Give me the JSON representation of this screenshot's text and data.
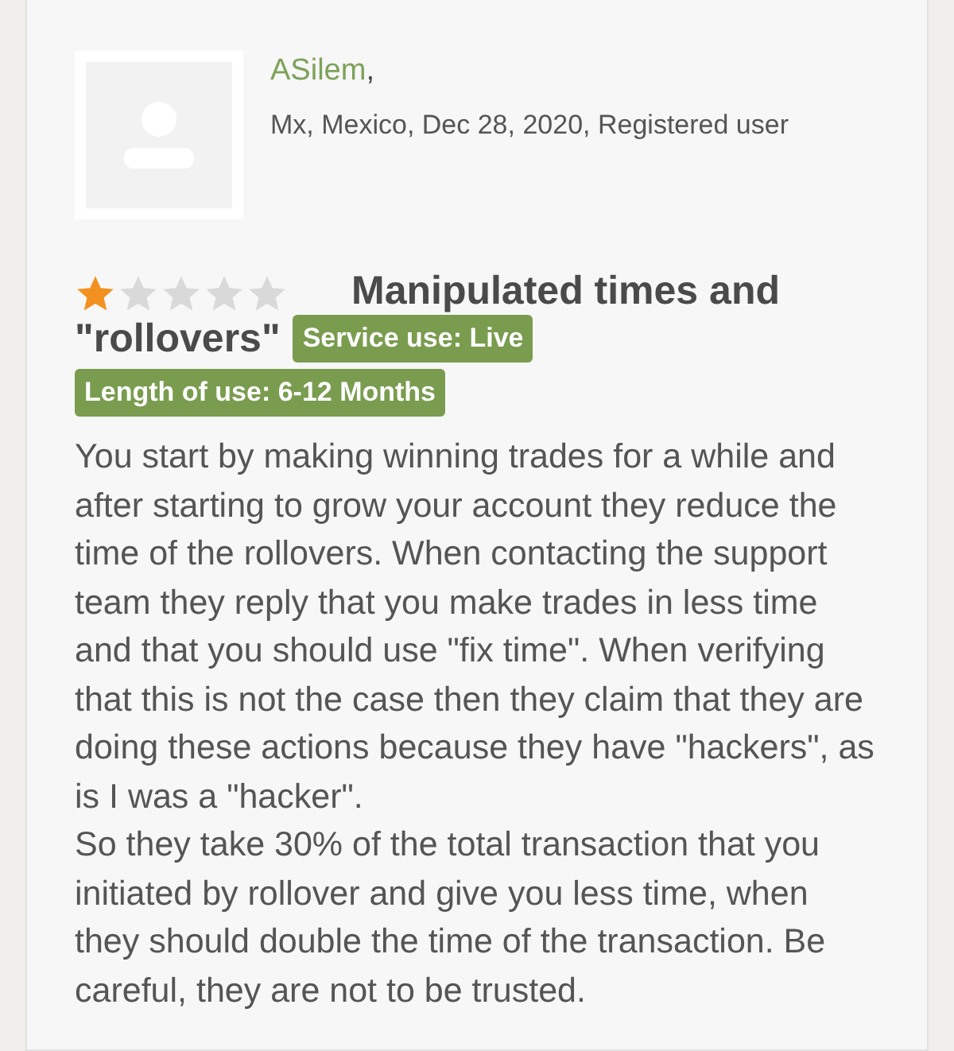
{
  "review": {
    "author": "ASilem",
    "author_suffix": ",",
    "meta": "Mx, Mexico, Dec 28, 2020, Registered user",
    "stars": 1,
    "title_lines": [
      "Manipulated times and",
      "\"rollovers\""
    ],
    "badges": [
      "Service use: Live",
      "Length of use: 6-12 Months"
    ],
    "paragraphs": [
      "You start by making winning trades for a while and after starting to grow your account they reduce the time of the rollovers. When contacting the support team they reply that you make trades in less time and that you should use \"fix time\". When verifying that this is not the case then they claim that they are doing these actions because they have \"hackers\", as is I was a \"hacker\".",
      "So they take 30% of the total transaction that you initiated by rollover and give you less time, when they should double the time of the transaction. Be careful, they are not to be trusted."
    ]
  }
}
